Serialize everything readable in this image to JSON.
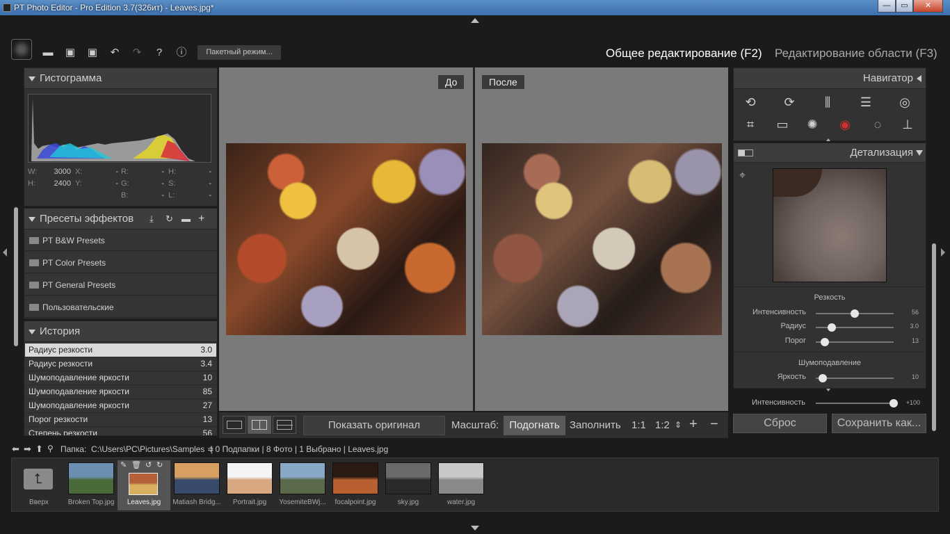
{
  "window": {
    "title": "PT Photo Editor - Pro Edition 3.7(326ит) - Leaves.jpg*",
    "btn_min": "—",
    "btn_max": "▭",
    "btn_close": "✕"
  },
  "toolbar": {
    "batch_label": "Пакетный режим...",
    "mode_general": "Общее редактирование (F2)",
    "mode_area": "Редактирование области (F3)"
  },
  "histogram": {
    "title": "Гистограмма",
    "rows": [
      [
        {
          "l": "W:",
          "v": "3000"
        },
        {
          "l": "X:",
          "v": "-"
        },
        {
          "l": "R:",
          "v": "-"
        },
        {
          "l": "H:",
          "v": "-"
        }
      ],
      [
        {
          "l": "H:",
          "v": "2400"
        },
        {
          "l": "Y:",
          "v": "-"
        },
        {
          "l": "G:",
          "v": "-"
        },
        {
          "l": "S:",
          "v": "-"
        }
      ],
      [
        {
          "l": "",
          "v": ""
        },
        {
          "l": "",
          "v": ""
        },
        {
          "l": "B:",
          "v": "-"
        },
        {
          "l": "L:",
          "v": "-"
        }
      ]
    ]
  },
  "presets": {
    "title": "Пресеты эффектов",
    "items": [
      "PT B&W Presets",
      "PT Color Presets",
      "PT General Presets",
      "Пользовательские"
    ]
  },
  "history": {
    "title": "История",
    "items": [
      {
        "label": "Радиус резкости",
        "value": "3.0"
      },
      {
        "label": "Радиус резкости",
        "value": "3.4"
      },
      {
        "label": "Шумоподавление яркости",
        "value": "10"
      },
      {
        "label": "Шумоподавление яркости",
        "value": "85"
      },
      {
        "label": "Шумоподавление яркости",
        "value": "27"
      },
      {
        "label": "Порог резкости",
        "value": "13"
      },
      {
        "label": "Степень резкости",
        "value": "56"
      }
    ]
  },
  "canvas": {
    "before_label": "До",
    "after_label": "После"
  },
  "bottom": {
    "show_original": "Показать оригинал",
    "scale_label": "Масштаб:",
    "fit": "Подогнать",
    "fill": "Заполнить",
    "z11": "1:1",
    "z12": "1:2"
  },
  "navigator": {
    "title": "Навигатор",
    "detail_title": "Детализация"
  },
  "sharpness": {
    "title": "Резкость",
    "sliders": [
      {
        "label": "Интенсивность",
        "value": "56",
        "fraction": 0.56
      },
      {
        "label": "Радиус",
        "value": "3.0",
        "fraction": 0.23
      },
      {
        "label": "Порог",
        "value": "13",
        "fraction": 0.13
      }
    ]
  },
  "noise": {
    "title": "Шумоподавление",
    "sliders": [
      {
        "label": "Яркость",
        "value": "10",
        "fraction": 0.1
      }
    ]
  },
  "intensity": {
    "label": "Интенсивность",
    "value": "+100",
    "fraction": 1.0
  },
  "actions": {
    "reset": "Сброс",
    "save_as": "Сохранить как..."
  },
  "pathbar": {
    "folder_label": "Папка:",
    "path": "C:\\Users\\PC\\Pictures\\Samples ≑",
    "info": "| 0 Подпапки | 8 Фото | 1 Выбрано | Leaves.jpg"
  },
  "filmstrip": {
    "up_label": "Вверх",
    "items": [
      {
        "name": "Broken Top.jpg",
        "c1": "#6b8fb0",
        "c2": "#4a6a3a"
      },
      {
        "name": "Leaves.jpg",
        "c1": "#b5603a",
        "c2": "#d8b060"
      },
      {
        "name": "Matiash Bridg...",
        "c1": "#d8a060",
        "c2": "#3a4a6a"
      },
      {
        "name": "Portrait.jpg",
        "c1": "#f4f4f4",
        "c2": "#d8a880"
      },
      {
        "name": "YosemiteBWj...",
        "c1": "#88a8c8",
        "c2": "#5a6a4a"
      },
      {
        "name": "focalpoint.jpg",
        "c1": "#2a1a14",
        "c2": "#b86030"
      },
      {
        "name": "sky.jpg",
        "c1": "#6a6a6a",
        "c2": "#2a2a2a"
      },
      {
        "name": "water.jpg",
        "c1": "#c8c8c8",
        "c2": "#8a8a8a"
      }
    ]
  }
}
